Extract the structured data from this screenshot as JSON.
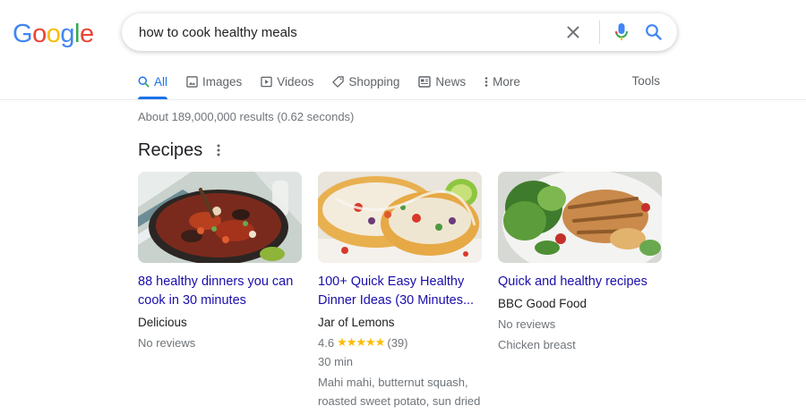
{
  "logo": {
    "letters": [
      "G",
      "o",
      "o",
      "g",
      "l",
      "e"
    ]
  },
  "colors": {
    "google_blue": "#4285F4",
    "google_red": "#EA4335",
    "google_yellow": "#FBBC05",
    "google_green": "#34A853",
    "link": "#1a0dab",
    "accent": "#1a73e8",
    "star": "#fbbc04"
  },
  "search": {
    "query": "how to cook healthy meals",
    "clear_icon": "close-icon",
    "mic_icon": "mic-icon",
    "search_icon": "search-icon"
  },
  "tabs": [
    {
      "label": "All",
      "icon": "search-icon",
      "active": true
    },
    {
      "label": "Images",
      "icon": "image-icon"
    },
    {
      "label": "Videos",
      "icon": "video-icon"
    },
    {
      "label": "Shopping",
      "icon": "tag-icon"
    },
    {
      "label": "News",
      "icon": "news-icon"
    },
    {
      "label": "More",
      "icon": "more-vert-icon"
    }
  ],
  "tools_label": "Tools",
  "stats": "About 189,000,000 results (0.62 seconds)",
  "recipes": {
    "title": "Recipes",
    "cards": [
      {
        "title_line1": "88 healthy dinners you can",
        "title_line2": "cook in 30 minutes",
        "source": "Delicious",
        "reviews": "No reviews",
        "image": "seafood paella pan"
      },
      {
        "title_line1": "100+ Quick Easy Healthy",
        "title_line2": "Dinner Ideas (30 Minutes...",
        "source": "Jar of Lemons",
        "rating": "4.6",
        "stars": "★★★★★",
        "review_count": "(39)",
        "time": "30 min",
        "ingredients_line1": "Mahi mahi, butternut squash,",
        "ingredients_line2": "roasted sweet potato, sun dried",
        "image": "fish tacos with lime"
      },
      {
        "title_line1": "Quick and healthy recipes",
        "source": "BBC Good Food",
        "reviews": "No reviews",
        "ingredient": "Chicken breast",
        "image": "chicken salad plate"
      }
    ]
  }
}
